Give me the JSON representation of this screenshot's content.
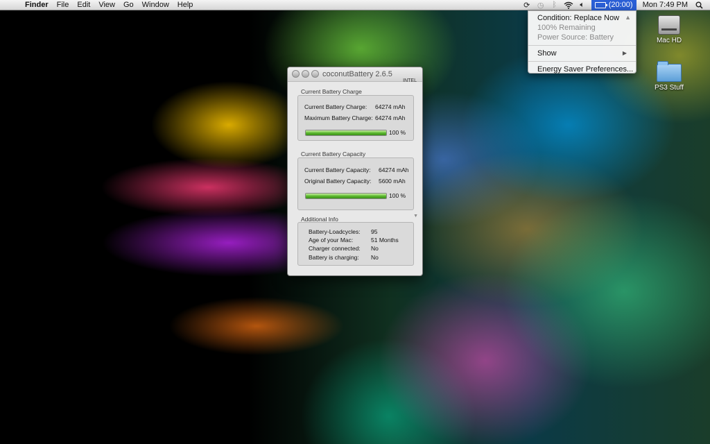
{
  "menubar": {
    "app_name": "Finder",
    "menus": [
      "File",
      "Edit",
      "View",
      "Go",
      "Window",
      "Help"
    ],
    "battery_time": "(20:00)",
    "clock": "Mon 7:49 PM",
    "icons": [
      "apple-icon",
      "sync-icon",
      "time-machine-icon",
      "bluetooth-icon",
      "wifi-icon",
      "volume-icon",
      "battery-icon",
      "spotlight-icon"
    ]
  },
  "battery_menu": {
    "condition": "Condition: Replace Now",
    "remaining": "100% Remaining",
    "power_source": "Power Source: Battery",
    "show_label": "Show",
    "energy_saver_label": "Energy Saver Preferences..."
  },
  "desktop": {
    "icons": [
      {
        "label": "Mac HD",
        "icon": "hard-drive-icon"
      },
      {
        "label": "PS3 Stuff",
        "icon": "folder-icon"
      }
    ]
  },
  "window": {
    "title": "coconutBattery 2.6.5",
    "badge": "INTEL",
    "current_charge": {
      "section": "Current Battery Charge",
      "current_label": "Current Battery Charge:",
      "current_value": "64274 mAh",
      "max_label": "Maximum Battery Charge:",
      "max_value": "64274 mAh",
      "percent": "100 %",
      "fill": 1.0
    },
    "capacity": {
      "section": "Current Battery Capacity",
      "current_label": "Current Battery Capacity:",
      "current_value": "64274 mAh",
      "original_label": "Original Battery Capacity:",
      "original_value": "5600 mAh",
      "percent": "100 %",
      "fill": 1.0
    },
    "info": {
      "section": "Additional Info",
      "rows": [
        {
          "label": "Battery-Loadcycles:",
          "value": "95"
        },
        {
          "label": "Age of your Mac:",
          "value": "51 Months"
        },
        {
          "label": "Charger connected:",
          "value": "No"
        },
        {
          "label": "Battery is charging:",
          "value": "No"
        }
      ]
    }
  }
}
